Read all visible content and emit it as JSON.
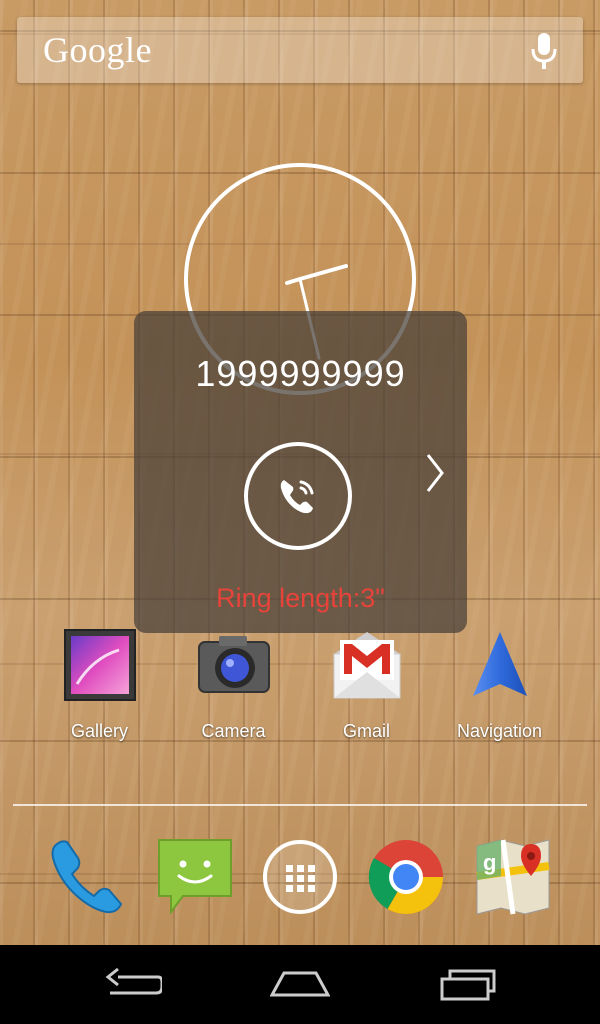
{
  "search": {
    "logo": "Google",
    "mic_icon": "microphone-icon"
  },
  "clock": {
    "type": "analog",
    "icon": "analog-clock"
  },
  "call_overlay": {
    "number": "1999999999",
    "call_icon": "phone-ringing-icon",
    "next_icon": "chevron-right-icon",
    "ring_length": "Ring length:3\"",
    "ring_color": "#e8433a"
  },
  "apps": [
    {
      "label": "Gallery",
      "icon": "gallery-icon"
    },
    {
      "label": "Camera",
      "icon": "camera-icon"
    },
    {
      "label": "Gmail",
      "icon": "gmail-icon"
    },
    {
      "label": "Navigation",
      "icon": "navigation-icon"
    }
  ],
  "dock": [
    {
      "icon": "phone-icon"
    },
    {
      "icon": "messaging-icon"
    },
    {
      "icon": "app-drawer-icon"
    },
    {
      "icon": "chrome-icon"
    },
    {
      "icon": "maps-icon"
    }
  ],
  "nav_bar": {
    "back_icon": "back-icon",
    "home_icon": "home-icon",
    "recents_icon": "recents-icon"
  }
}
